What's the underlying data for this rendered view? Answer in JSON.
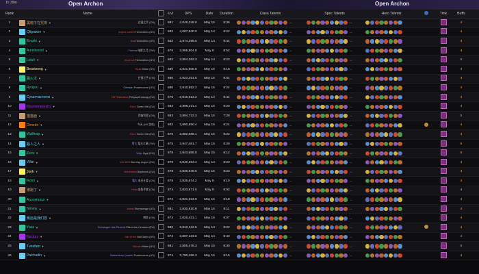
{
  "banner": {
    "tag": "1h 39m",
    "archon_left": "Open Archon",
    "archon_right": "Open Archon"
  },
  "headers": {
    "rank": "Rank",
    "name": "Name",
    "ilvl": "iLvl",
    "dps": "DPS",
    "date": "Date",
    "duration": "Duration",
    "class": "Class Talents",
    "spec": "Spec Talents",
    "hero": "Hero Talents",
    "trink": "Trnk",
    "buffs": "Buffs"
  },
  "rows": [
    {
      "rank": "1",
      "name": "黑暗子在咒夜",
      "color": "#c79c6e",
      "guild": "",
      "realm": "白银之手 (CN)",
      "guild_color": "#bbb",
      "ilvl": "681",
      "dps": "4,049,348.0",
      "date": "May 15",
      "dur": "8:36",
      "buffs": "4"
    },
    {
      "rank": "2",
      "name": "Qllgraken",
      "color": "#69ccf0",
      "guild": "project comb0",
      "realm": "Tichondrius (US)",
      "guild_color": "#e04848",
      "ilvl": "682",
      "dps": "4,007,840.0",
      "date": "May 14",
      "dur": "8:22",
      "buffs": "4"
    },
    {
      "rank": "3",
      "name": "Evoski",
      "color": "#33c5a0",
      "guild": "Bal",
      "realm": "Tichondrius (US)",
      "guild_color": "#e04848",
      "ilvl": "682",
      "dps": "3,974,289.5",
      "date": "May 14",
      "dur": "8:44",
      "buffs": "4"
    },
    {
      "rank": "4",
      "name": "Aurelionsol",
      "color": "#33c5a0",
      "guild": "Forbow",
      "realm": "暗影之月 (TW)",
      "guild_color": "#8a8aff",
      "ilvl": "676",
      "dps": "3,965,804.0",
      "date": "May 8",
      "dur": "8:52",
      "buffs": "4"
    },
    {
      "rank": "5",
      "name": "Loluh",
      "color": "#33c5a0",
      "guild": "incorrolo",
      "realm": "Tichondrius (US)",
      "guild_color": "#e04848",
      "ilvl": "682",
      "dps": "3,954,353.3",
      "date": "May 14",
      "dur": "8:23",
      "buffs": "5"
    },
    {
      "rank": "6",
      "name": "Beastsong",
      "color": "#fff468",
      "guild": "Hyas",
      "realm": "Illidan (US)",
      "guild_color": "#e04848",
      "ilvl": "680",
      "dps": "3,941,808.8",
      "date": "May 15",
      "dur": "8:18",
      "buffs": "4"
    },
    {
      "rank": "7",
      "name": "霜火尤",
      "color": "#33c5a0",
      "guild": "",
      "realm": "白银之手 (CN)",
      "guild_color": "#bbb",
      "ilvl": "680",
      "dps": "3,923,251.5",
      "date": "May 15",
      "dur": "8:04",
      "buffs": "4"
    },
    {
      "rank": "8",
      "name": "Ryuyuu",
      "color": "#33c5a0",
      "guild": "Crimson",
      "realm": "Frostmourne (US)",
      "guild_color": "#69ccf0",
      "ilvl": "680",
      "dps": "3,910,552.2",
      "date": "May 15",
      "dur": "8:24",
      "buffs": "4"
    },
    {
      "rank": "9",
      "name": "Сухаячаклогок",
      "color": "#69ccf0",
      "guild": "Ой Пенесвесь",
      "realm": "Ревущий фьорд (EU)",
      "guild_color": "#e04848",
      "ilvl": "676",
      "dps": "3,910,513.2",
      "date": "May 14",
      "dur": "8:44",
      "buffs": "4"
    },
    {
      "rank": "10",
      "name": "Nicemenesechs",
      "color": "#a335ee",
      "guild": "Echo",
      "realm": "Tarren Mill (EU)",
      "guild_color": "#e04848",
      "ilvl": "683",
      "dps": "3,898,211.4",
      "date": "May 15",
      "dur": "8:20",
      "buffs": "4"
    },
    {
      "rank": "11",
      "name": "猫猫面",
      "color": "#c79c6e",
      "guild": "",
      "realm": "伊森利恩 (CN)",
      "guild_color": "#bbb",
      "ilvl": "683",
      "dps": "3,894,723.3",
      "date": "May 15",
      "dur": "7:28",
      "buffs": "5"
    },
    {
      "rank": "12",
      "name": "Dimedri",
      "color": "#ff7d0a",
      "guild": "",
      "realm": "今天 (US 游戏)",
      "guild_color": "#bbb",
      "ilvl": "682",
      "dps": "3,890,850.4",
      "date": "May 15",
      "dur": "8:24",
      "buffs": "4"
    },
    {
      "rank": "13",
      "name": "Wallfeap",
      "color": "#33c5a0",
      "guild": "Echo",
      "realm": "Tarren Mill (EU)",
      "guild_color": "#e04848",
      "ilvl": "675",
      "dps": "3,882,089.1",
      "date": "May 15",
      "dur": "8:22",
      "buffs": "4"
    },
    {
      "rank": "14",
      "name": "殺人之人",
      "color": "#69ccf0",
      "guild": "雪大",
      "realm": "聖光之願 (TW)",
      "guild_color": "#8a8aff",
      "ilvl": "675",
      "dps": "3,847,481.7",
      "date": "May 15",
      "dur": "8:29",
      "buffs": "5"
    },
    {
      "rank": "15",
      "name": "Zeris",
      "color": "#33c5a0",
      "guild": "Wisp",
      "realm": "Hyjal (EU)",
      "guild_color": "#8a8aff",
      "ilvl": "678",
      "dps": "3,843,668.0",
      "date": "May 15",
      "dur": "8:12",
      "buffs": "5"
    },
    {
      "rank": "16",
      "name": "Vilkn",
      "color": "#69ccf0",
      "guild": "WICKED",
      "realm": "Burning Legion (EU)",
      "guild_color": "#e04848",
      "ilvl": "678",
      "dps": "3,840,263.4",
      "date": "May 14",
      "dur": "8:23",
      "buffs": "4"
    },
    {
      "rank": "17",
      "name": "Jonk",
      "color": "#fff468",
      "guild": "Narcbassa",
      "realm": "Blackrock (EU)",
      "guild_color": "#e04848",
      "ilvl": "678",
      "dps": "3,836,949.5",
      "date": "May 15",
      "dur": "8:23",
      "buffs": "4"
    },
    {
      "rank": "18",
      "name": "Ikomi",
      "color": "#33c5a0",
      "guild": "霜大",
      "realm": "来日什爱 (CN)",
      "guild_color": "#8a8aff",
      "ilvl": "678",
      "dps": "3,835,674.2",
      "date": "May 9",
      "dur": "9:10",
      "buffs": "4"
    },
    {
      "rank": "19",
      "name": "哪跑了",
      "color": "#c79c6e",
      "guild": "Hidai",
      "realm": "金色手掌 (CN)",
      "guild_color": "#e04848",
      "ilvl": "674",
      "dps": "3,833,971.6",
      "date": "May 9",
      "dur": "9:02",
      "buffs": "4"
    },
    {
      "rank": "20",
      "name": "Anonymous",
      "color": "#33c5a0",
      "guild": "",
      "realm": "",
      "guild_color": "#bbb",
      "ilvl": "674",
      "dps": "3,831,533.0",
      "date": "May 15",
      "dur": "8:18",
      "buffs": "4"
    },
    {
      "rank": "21",
      "name": "Nimmy",
      "color": "#33c5a0",
      "guild": "ludied",
      "realm": "Stormwrage (US)",
      "guild_color": "#e04848",
      "ilvl": "681",
      "dps": "3,830,910.9",
      "date": "May 15",
      "dur": "8:11",
      "buffs": "4"
    },
    {
      "rank": "22",
      "name": "最后是我们冒",
      "color": "#69ccf0",
      "guild": "",
      "realm": "鳄鱼 (CN)",
      "guild_color": "#bbb",
      "ilvl": "674",
      "dps": "3,826,431.1",
      "date": "May 15",
      "dur": "8:07",
      "buffs": "4"
    },
    {
      "rank": "23",
      "name": "Yasa",
      "color": "#33c5a0",
      "guild": "Schwingen des Phoenix",
      "realm": "Zirkel des Cenarius (EU)",
      "guild_color": "#8a8aff",
      "ilvl": "680",
      "dps": "3,810,132.5",
      "date": "May 14",
      "dur": "8:22",
      "buffs": "4"
    },
    {
      "rank": "24",
      "name": "Nocturs",
      "color": "#a335ee",
      "guild": "Just of me",
      "realm": "Mal'Ganis (US)",
      "guild_color": "#e04848",
      "ilvl": "674",
      "dps": "3,807,133.6",
      "date": "May 14",
      "dur": "8:43",
      "buffs": "4"
    },
    {
      "rank": "25",
      "name": "Tunafam",
      "color": "#69ccf0",
      "guild": "Viscum",
      "realm": "Illidan (US)",
      "guild_color": "#e04848",
      "ilvl": "681",
      "dps": "3,805,478.3",
      "date": "May 15",
      "dur": "8:30",
      "buffs": "5"
    },
    {
      "rank": "26",
      "name": "Palchadin",
      "color": "#69ccf0",
      "guild": "Barbershop Quartet",
      "realm": "Frostmourne (US)",
      "guild_color": "#8a8aff",
      "ilvl": "674",
      "dps": "3,790,456.3",
      "date": "May 15",
      "dur": "9:15",
      "buffs": "4"
    }
  ],
  "talent_colors": [
    "#b8742a",
    "#5a8fd0",
    "#cf4a2a",
    "#8a5ab8",
    "#d6b23a",
    "#4a9a4a",
    "#c06030",
    "#6070c0"
  ]
}
